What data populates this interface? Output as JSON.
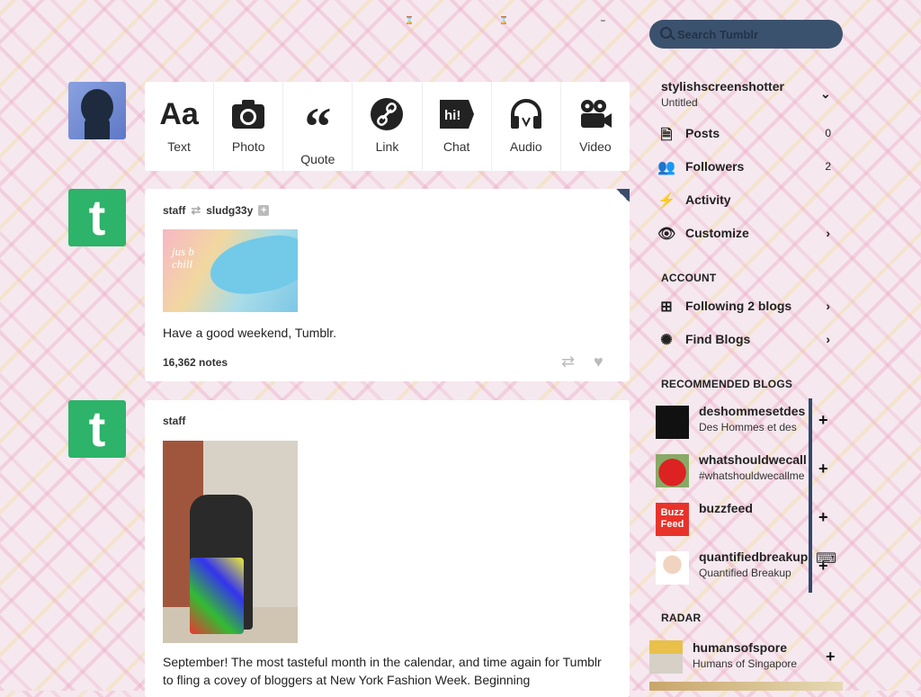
{
  "search": {
    "placeholder": "Search Tumblr"
  },
  "composer": {
    "types": [
      {
        "label": "Text",
        "icon": "text-icon"
      },
      {
        "label": "Photo",
        "icon": "camera-icon"
      },
      {
        "label": "Quote",
        "icon": "quote-icon"
      },
      {
        "label": "Link",
        "icon": "link-icon"
      },
      {
        "label": "Chat",
        "icon": "chat-icon"
      },
      {
        "label": "Audio",
        "icon": "headphones-icon"
      },
      {
        "label": "Video",
        "icon": "video-camera-icon"
      }
    ]
  },
  "posts": [
    {
      "author": "staff",
      "reblog_from": "sludg33y",
      "image_text": "jus b chill",
      "caption": "Have a good weekend, Tumblr.",
      "notes": "16,362 notes"
    },
    {
      "author": "staff",
      "body": "September! The most tasteful month in the calendar, and time again for Tumblr to fling a covey of bloggers at New York Fashion Week. Beginning"
    }
  ],
  "sidebar": {
    "blog_name": "stylishscreenshotter",
    "blog_title": "Untitled",
    "items": [
      {
        "label": "Posts",
        "count": "0",
        "icon": "document-icon"
      },
      {
        "label": "Followers",
        "count": "2",
        "icon": "people-icon"
      },
      {
        "label": "Activity",
        "icon": "lightning-icon"
      },
      {
        "label": "Customize",
        "icon": "eye-icon"
      }
    ],
    "account_heading": "ACCOUNT",
    "account_items": [
      {
        "label": "Following 2 blogs",
        "icon": "add-person-icon"
      },
      {
        "label": "Find Blogs",
        "icon": "compass-icon"
      }
    ],
    "recommended_heading": "RECOMMENDED BLOGS",
    "recommended": [
      {
        "name": "deshommesetdes",
        "subtitle": "Des Hommes et des"
      },
      {
        "name": "whatshouldwecall",
        "subtitle": "#whatshouldwecallme"
      },
      {
        "name": "buzzfeed",
        "subtitle": ""
      },
      {
        "name": "quantifiedbreakup",
        "subtitle": "Quantified Breakup"
      }
    ],
    "radar_heading": "RADAR",
    "radar": {
      "name": "humansofspore",
      "subtitle": "Humans of Singapore"
    }
  },
  "colors": {
    "accent": "#3b526e",
    "tumblr_green": "#2db36a"
  }
}
